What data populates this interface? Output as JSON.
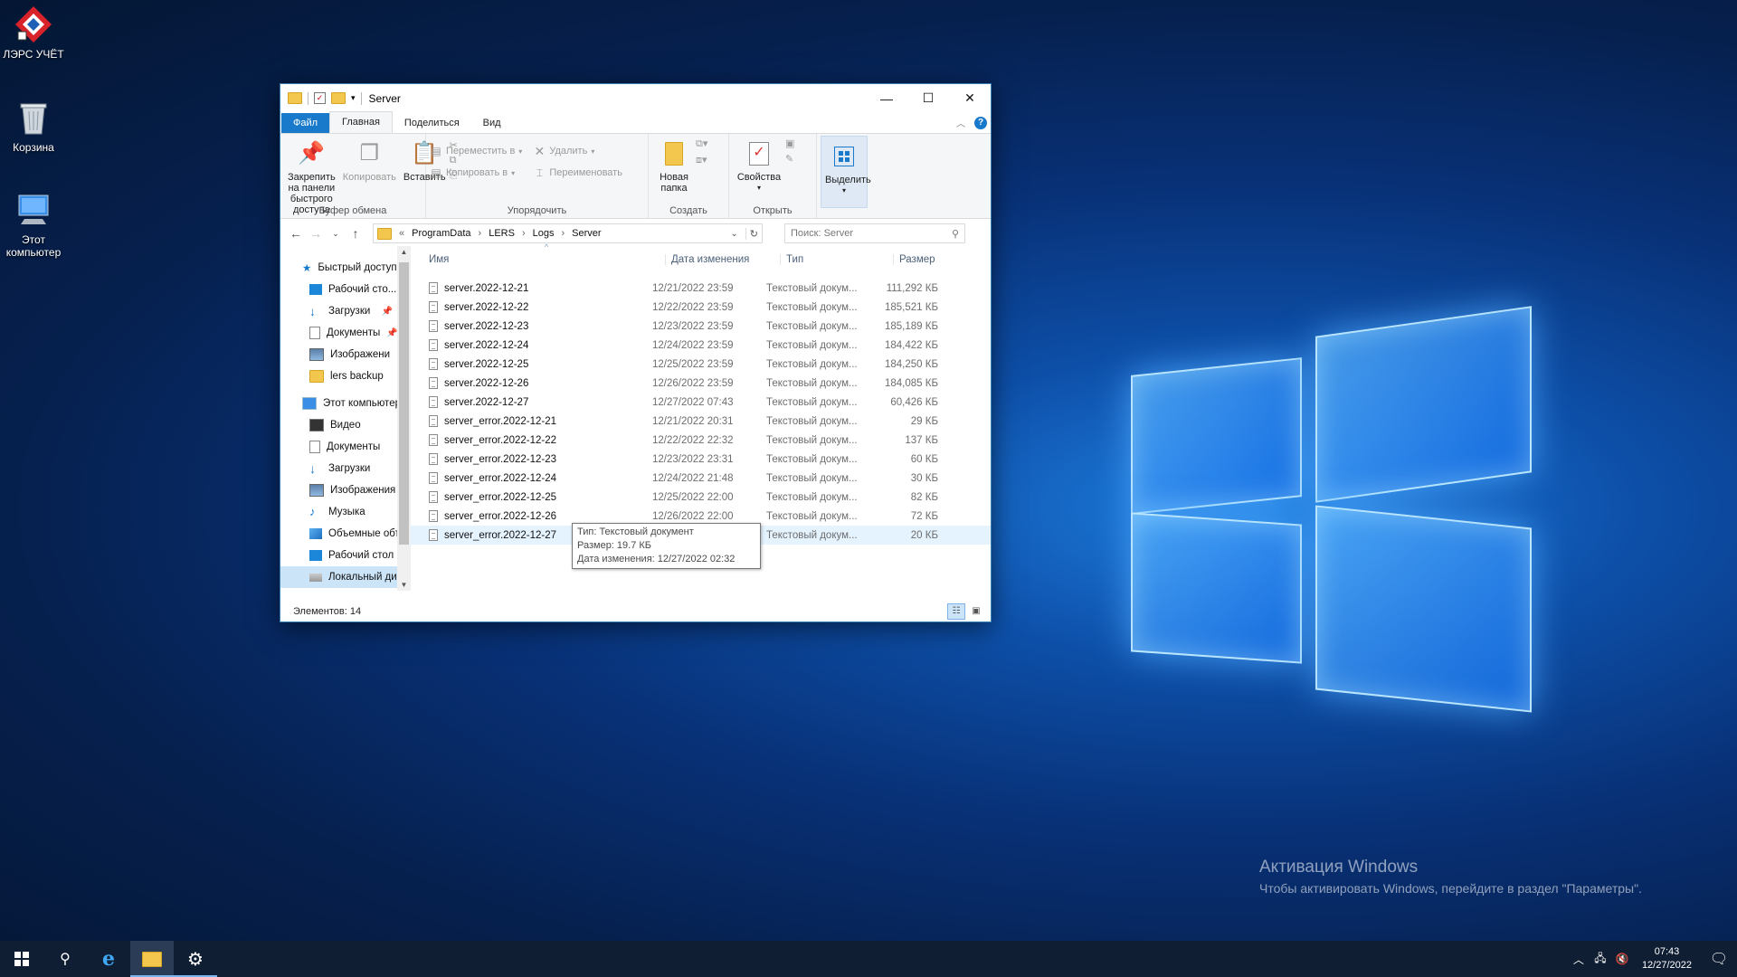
{
  "desktop": {
    "icons": [
      {
        "label": "ЛЭРС УЧЁТ"
      },
      {
        "label": "Корзина"
      },
      {
        "label": "Этот компьютер"
      }
    ],
    "activation": {
      "title": "Активация Windows",
      "subtitle": "Чтобы активировать Windows, перейдите в раздел \"Параметры\"."
    }
  },
  "explorer": {
    "title": "Server",
    "window_controls": {
      "minimize": "—",
      "maximize": "☐",
      "close": "✕"
    },
    "tabs": [
      "Файл",
      "Главная",
      "Поделиться",
      "Вид"
    ],
    "ribbon": {
      "clipboard": {
        "group": "Буфер обмена",
        "pin": "Закрепить на панели быстрого доступа",
        "copy": "Копировать",
        "paste": "Вставить"
      },
      "organize": {
        "group": "Упорядочить",
        "move_to": "Переместить в",
        "copy_to": "Копировать в",
        "delete": "Удалить",
        "rename": "Переименовать"
      },
      "create": {
        "group": "Создать",
        "new_folder": "Новая папка"
      },
      "open": {
        "group": "Открыть",
        "properties": "Свойства"
      },
      "select": {
        "select": "Выделить"
      }
    },
    "address": {
      "crumbs": [
        "ProgramData",
        "LERS",
        "Logs",
        "Server"
      ],
      "search_placeholder": "Поиск: Server"
    },
    "nav": {
      "quick_access": "Быстрый доступ",
      "quick_items": [
        {
          "label": "Рабочий сто...",
          "pinned": true
        },
        {
          "label": "Загрузки",
          "pinned": true
        },
        {
          "label": "Документы",
          "pinned": true
        },
        {
          "label": "Изображени",
          "pinned": true
        },
        {
          "label": "lers backup",
          "pinned": false
        }
      ],
      "this_pc": "Этот компьютер",
      "pc_items": [
        "Видео",
        "Документы",
        "Загрузки",
        "Изображения",
        "Музыка",
        "Объемные объ",
        "Рабочий стол",
        "Локальный дис"
      ]
    },
    "columns": {
      "name": "Имя",
      "date": "Дата изменения",
      "type": "Тип",
      "size": "Размер"
    },
    "files": [
      {
        "name": "server.2022-12-21",
        "date": "12/21/2022 23:59",
        "type": "Текстовый докум...",
        "size": "111,292 КБ"
      },
      {
        "name": "server.2022-12-22",
        "date": "12/22/2022 23:59",
        "type": "Текстовый докум...",
        "size": "185,521 КБ"
      },
      {
        "name": "server.2022-12-23",
        "date": "12/23/2022 23:59",
        "type": "Текстовый докум...",
        "size": "185,189 КБ"
      },
      {
        "name": "server.2022-12-24",
        "date": "12/24/2022 23:59",
        "type": "Текстовый докум...",
        "size": "184,422 КБ"
      },
      {
        "name": "server.2022-12-25",
        "date": "12/25/2022 23:59",
        "type": "Текстовый докум...",
        "size": "184,250 КБ"
      },
      {
        "name": "server.2022-12-26",
        "date": "12/26/2022 23:59",
        "type": "Текстовый докум...",
        "size": "184,085 КБ"
      },
      {
        "name": "server.2022-12-27",
        "date": "12/27/2022 07:43",
        "type": "Текстовый докум...",
        "size": "60,426 КБ"
      },
      {
        "name": "server_error.2022-12-21",
        "date": "12/21/2022 20:31",
        "type": "Текстовый докум...",
        "size": "29 КБ"
      },
      {
        "name": "server_error.2022-12-22",
        "date": "12/22/2022 22:32",
        "type": "Текстовый докум...",
        "size": "137 КБ"
      },
      {
        "name": "server_error.2022-12-23",
        "date": "12/23/2022 23:31",
        "type": "Текстовый докум...",
        "size": "60 КБ"
      },
      {
        "name": "server_error.2022-12-24",
        "date": "12/24/2022 21:48",
        "type": "Текстовый докум...",
        "size": "30 КБ"
      },
      {
        "name": "server_error.2022-12-25",
        "date": "12/25/2022 22:00",
        "type": "Текстовый докум...",
        "size": "82 КБ"
      },
      {
        "name": "server_error.2022-12-26",
        "date": "12/26/2022 22:00",
        "type": "Текстовый докум...",
        "size": "72 КБ"
      },
      {
        "name": "server_error.2022-12-27",
        "date": "12/27/2022 02:32",
        "type": "Текстовый докум...",
        "size": "20 КБ"
      }
    ],
    "tooltip": {
      "type": "Тип: Текстовый документ",
      "size": "Размер: 19.7 КБ",
      "date": "Дата изменения: 12/27/2022 02:32"
    },
    "status": "Элементов: 14"
  },
  "taskbar": {
    "time": "07:43",
    "date": "12/27/2022"
  },
  "colors": {
    "accent": "#1979ca",
    "folder": "#f3c64d",
    "taskbar": "#0f1e33",
    "hover_row": "#e5f3ff"
  }
}
